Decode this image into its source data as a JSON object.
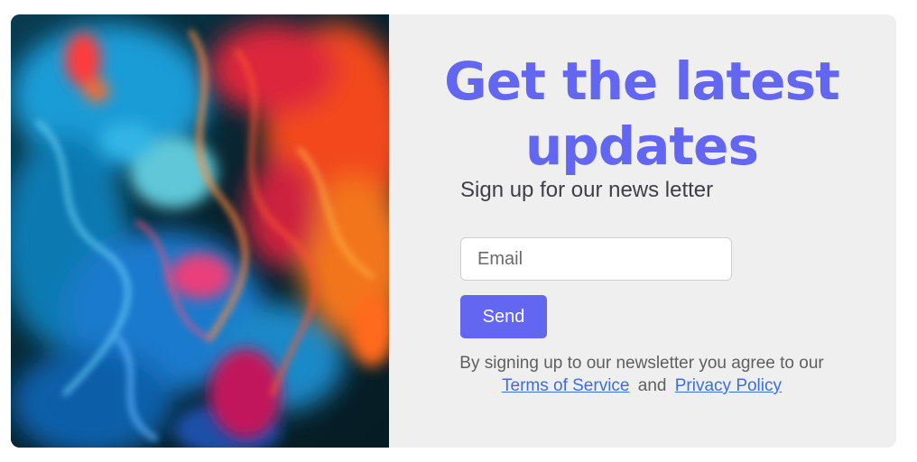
{
  "signup": {
    "title": "Get the latest updates",
    "subtitle": "Sign up for our news letter",
    "email_placeholder": "Email",
    "send_label": "Send",
    "legal_prefix": "By signing up to our newsletter you agree to our",
    "terms_label": "Terms of Service",
    "and_text": "and",
    "privacy_label": "Privacy Policy"
  },
  "colors": {
    "accent": "#6366f1",
    "card_bg": "#efefef",
    "link": "#3b6fe0"
  }
}
